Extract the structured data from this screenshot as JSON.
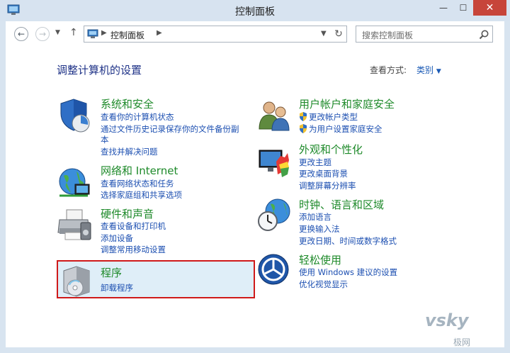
{
  "window": {
    "title": "控制面板"
  },
  "toolbar": {
    "address_crumb": "控制面板",
    "search_placeholder": "搜索控制面板"
  },
  "page": {
    "heading": "调整计算机的设置",
    "view_label": "查看方式:",
    "view_value": "类别"
  },
  "categories": {
    "system": {
      "title": "系统和安全",
      "links": [
        "查看你的计算机状态",
        "通过文件历史记录保存你的文件备份副",
        "本",
        "查找并解决问题"
      ]
    },
    "network": {
      "title": "网络和 Internet",
      "links": [
        "查看网络状态和任务",
        "选择家庭组和共享选项"
      ]
    },
    "hardware": {
      "title": "硬件和声音",
      "links": [
        "查看设备和打印机",
        "添加设备",
        "调整常用移动设置"
      ]
    },
    "programs": {
      "title": "程序",
      "links": [
        "卸载程序"
      ]
    },
    "users": {
      "title": "用户帐户和家庭安全",
      "links": [
        "更改帐户类型",
        "为用户设置家庭安全"
      ]
    },
    "appearance": {
      "title": "外观和个性化",
      "links": [
        "更改主题",
        "更改桌面背景",
        "调整屏幕分辨率"
      ]
    },
    "clock": {
      "title": "时钟、语言和区域",
      "links": [
        "添加语言",
        "更换输入法",
        "更改日期、时间或数字格式"
      ]
    },
    "ease": {
      "title": "轻松使用",
      "links": [
        "使用 Windows 建议的设置",
        "优化视觉显示"
      ]
    }
  },
  "watermark": {
    "text": "vsky",
    "sub": "极网"
  },
  "colors": {
    "link": "#1c4fb1",
    "category_title": "#1e8a2a",
    "heading": "#1e3287",
    "highlight_border": "#cf1a1a",
    "close_button": "#c7453a"
  }
}
